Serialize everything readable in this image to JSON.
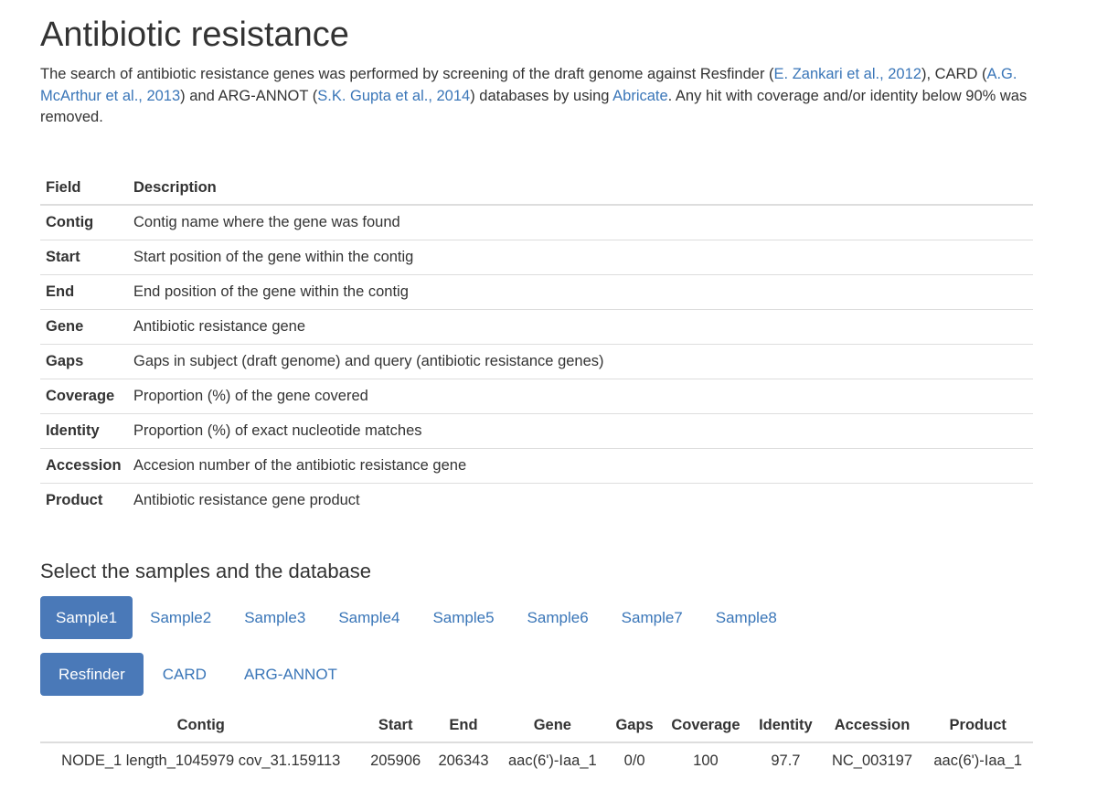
{
  "title": "Antibiotic resistance",
  "intro": {
    "text1": "The search of antibiotic resistance genes was performed by screening of the draft genome against Resfinder (",
    "link1": "E. Zankari et al., 2012",
    "text2": "), CARD (",
    "link2": "A.G. McArthur et al., 2013",
    "text3": ") and ARG-ANNOT (",
    "link3": "S.K. Gupta et al., 2014",
    "text4": ") databases by using ",
    "link4": "Abricate",
    "text5": ". Any hit with coverage and/or identity below 90% was removed."
  },
  "fields_table": {
    "headers": [
      "Field",
      "Description"
    ],
    "rows": [
      {
        "field": "Contig",
        "description": "Contig name where the gene was found"
      },
      {
        "field": "Start",
        "description": "Start position of the gene within the contig"
      },
      {
        "field": "End",
        "description": "End position of the gene within the contig"
      },
      {
        "field": "Gene",
        "description": "Antibiotic resistance gene"
      },
      {
        "field": "Gaps",
        "description": "Gaps in subject (draft genome) and query (antibiotic resistance genes)"
      },
      {
        "field": "Coverage",
        "description": "Proportion (%) of the gene covered"
      },
      {
        "field": "Identity",
        "description": "Proportion (%) of exact nucleotide matches"
      },
      {
        "field": "Accession",
        "description": "Accesion number of the antibiotic resistance gene"
      },
      {
        "field": "Product",
        "description": "Antibiotic resistance gene product"
      }
    ]
  },
  "select_heading": "Select the samples and the database",
  "samples": {
    "active": "Sample1",
    "items": [
      "Sample1",
      "Sample2",
      "Sample3",
      "Sample4",
      "Sample5",
      "Sample6",
      "Sample7",
      "Sample8"
    ]
  },
  "databases": {
    "active": "Resfinder",
    "items": [
      "Resfinder",
      "CARD",
      "ARG-ANNOT"
    ]
  },
  "results_table": {
    "headers": [
      "Contig",
      "Start",
      "End",
      "Gene",
      "Gaps",
      "Coverage",
      "Identity",
      "Accession",
      "Product"
    ],
    "rows": [
      [
        "NODE_1 length_1045979 cov_31.159113",
        "205906",
        "206343",
        "aac(6')-Iaa_1",
        "0/0",
        "100",
        "97.7",
        "NC_003197",
        "aac(6')-Iaa_1"
      ]
    ]
  },
  "colors": {
    "link": "#3a76b8",
    "active_pill": "#4a79b8",
    "rule": "#dddddd"
  }
}
